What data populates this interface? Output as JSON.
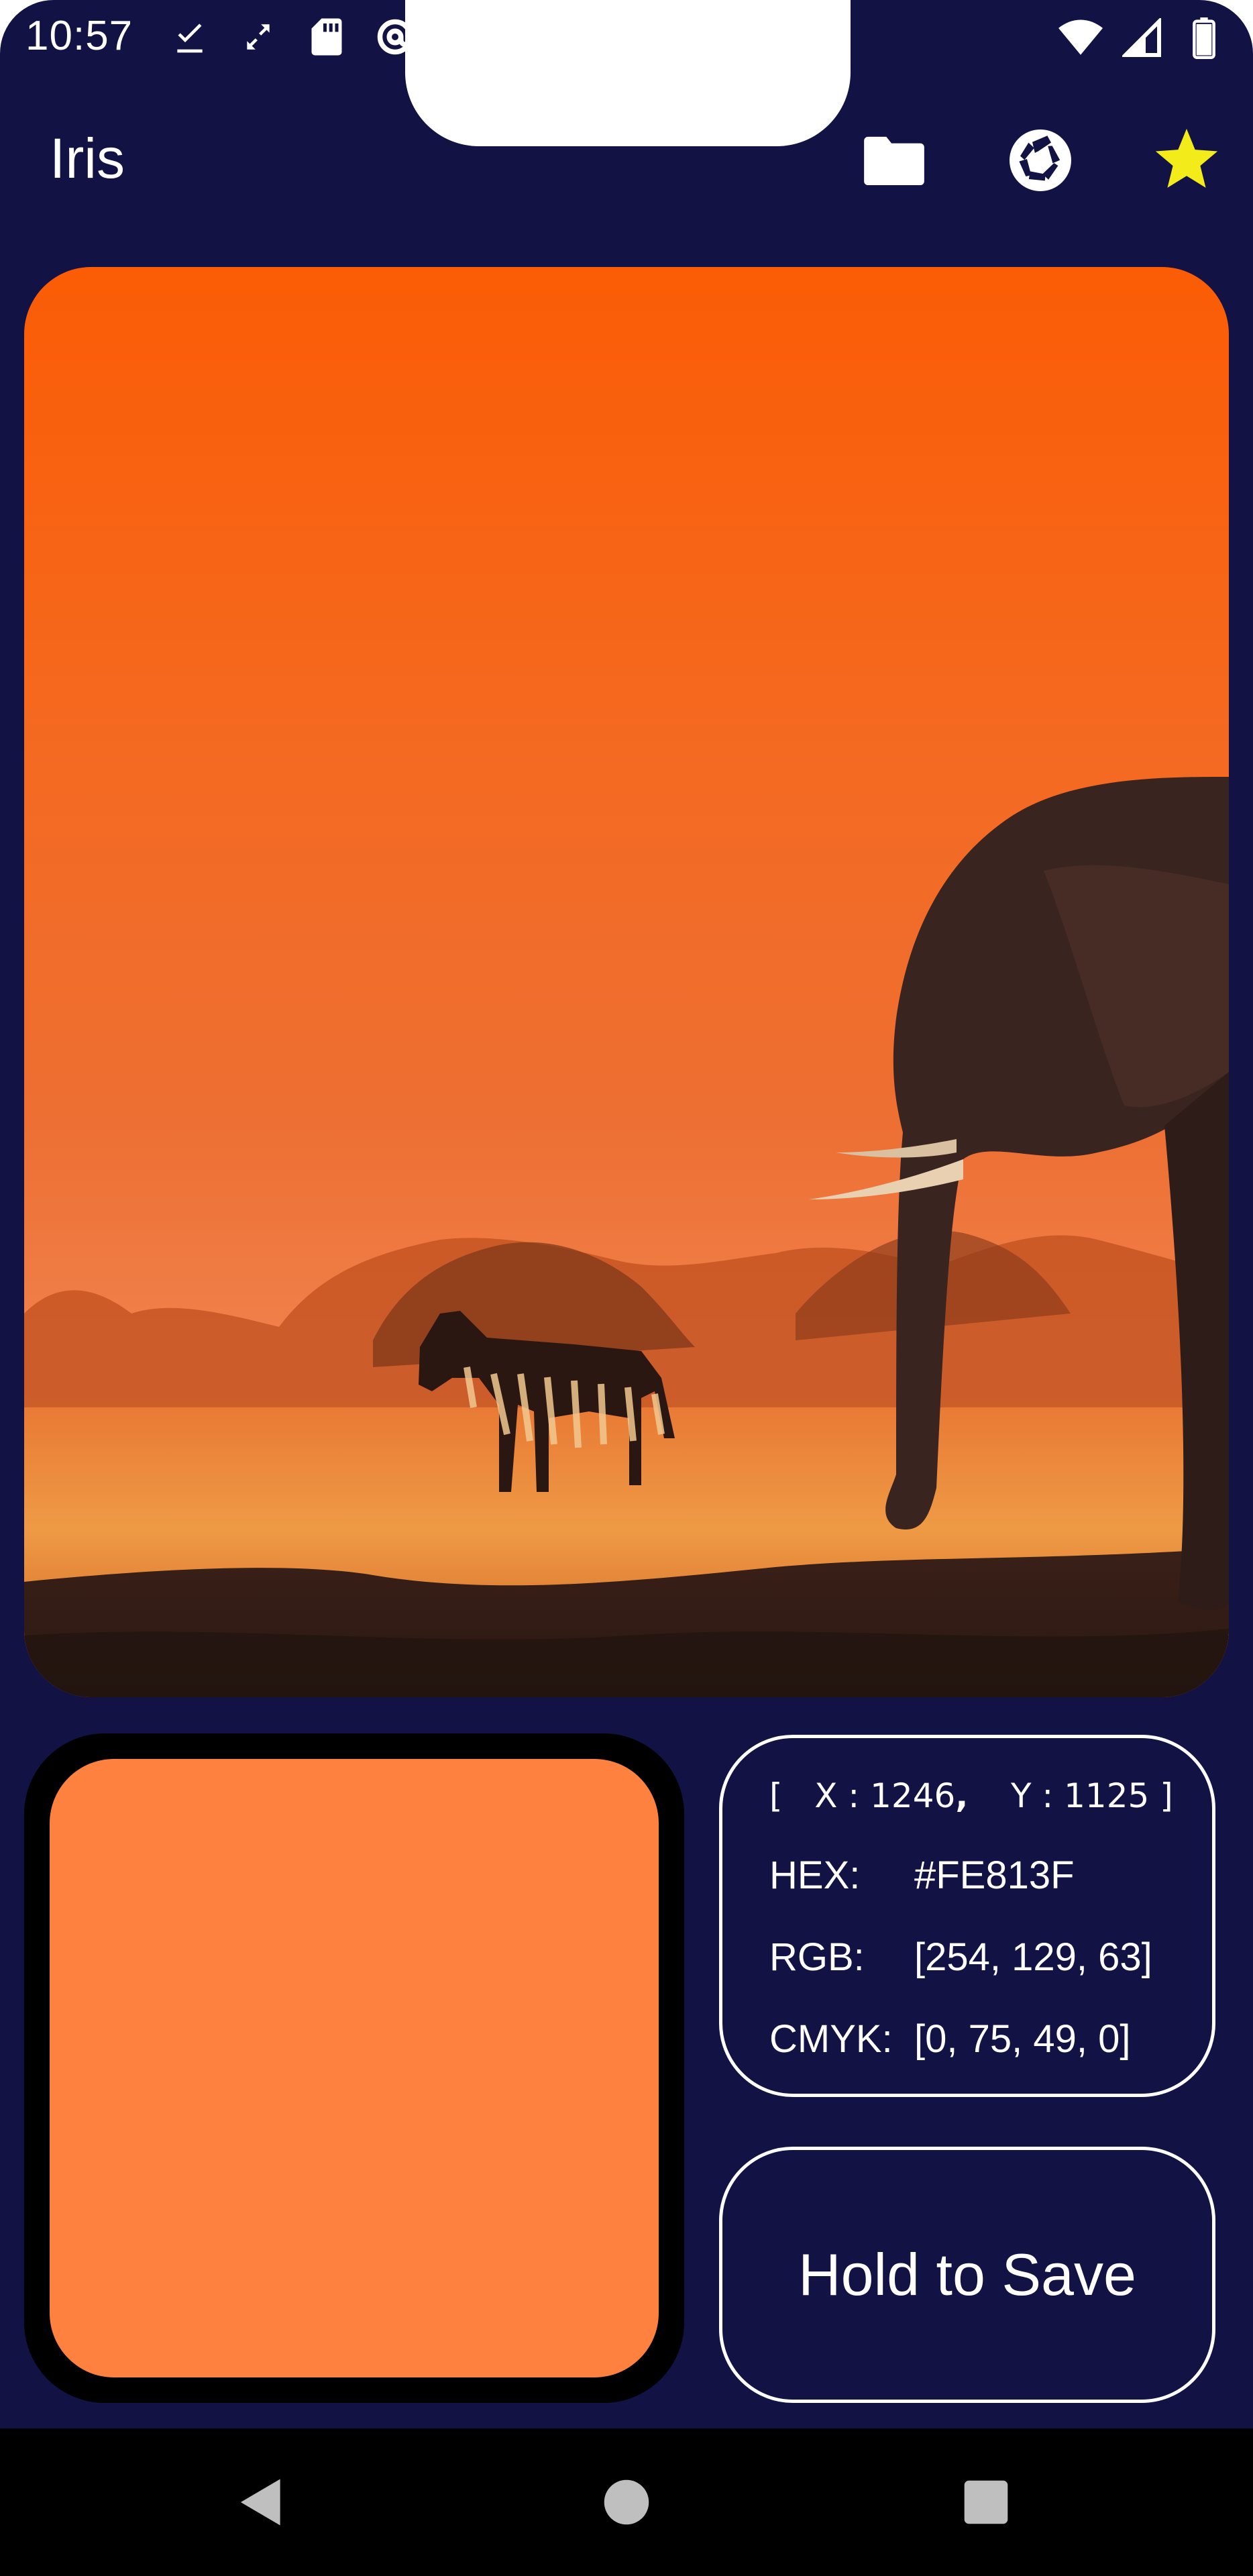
{
  "status_bar": {
    "time": "10:57",
    "left_icons": [
      "download-done-icon",
      "sync-icon",
      "sd-card-icon",
      "at-sign-icon"
    ],
    "right_icons": [
      "wifi-icon",
      "cell-signal-icon",
      "battery-icon"
    ]
  },
  "app_bar": {
    "title": "Iris",
    "actions": [
      "folder-icon",
      "camera-shutter-icon",
      "star-icon"
    ],
    "star_color": "#f4ec1a"
  },
  "image": {
    "description_icon": "photo-savanna-elephant-zebra"
  },
  "picked_color": {
    "swatch_color": "#FE813F",
    "coords": {
      "x_label": "X :",
      "x_value": "1246",
      "separator": ",",
      "y_label": "Y :",
      "y_value": "1125",
      "open_bracket": "[",
      "close_bracket": "]"
    },
    "hex_label": "HEX:",
    "hex_value": "#FE813F",
    "rgb_label": "RGB:",
    "rgb_value": "[254, 129, 63]",
    "cmyk_label": "CMYK:",
    "cmyk_value": "[0, 75, 49, 0]"
  },
  "save_button": {
    "label": "Hold to Save"
  },
  "nav_bar": {
    "buttons": [
      "back-icon",
      "home-icon",
      "recents-icon"
    ]
  },
  "colors": {
    "background": "#121244",
    "swatch_frame": "#000000",
    "nav_bar": "#000000"
  }
}
